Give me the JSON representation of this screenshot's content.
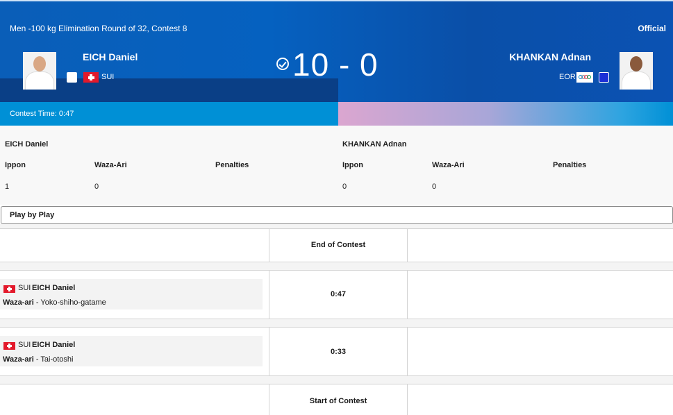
{
  "header": {
    "contest_title": "Men -100 kg Elimination Round of 32, Contest 8",
    "status": "Official",
    "contest_time": "Contest Time: 0:47",
    "score": "10 - 0"
  },
  "athletes": {
    "left": {
      "name": "EICH Daniel",
      "noc": "SUI",
      "judogi": "white",
      "judogi_color": "#ffffff"
    },
    "right": {
      "name": "KHANKAN Adnan",
      "noc": "EOR",
      "judogi": "blue",
      "judogi_color": "#1b2fd6"
    }
  },
  "stats": {
    "left": {
      "name": "EICH Daniel",
      "ippon_label": "Ippon",
      "wazaari_label": "Waza-Ari",
      "penalties_label": "Penalties",
      "ippon": "1",
      "wazaari": "0"
    },
    "right": {
      "name": "KHANKAN Adnan",
      "ippon_label": "Ippon",
      "wazaari_label": "Waza-Ari",
      "penalties_label": "Penalties",
      "ippon": "0",
      "wazaari": "0"
    }
  },
  "play_by_play": {
    "title": "Play by Play",
    "end_label": "End of Contest",
    "start_label": "Start of Contest",
    "events": [
      {
        "noc": "SUI",
        "athlete": "EICH Daniel",
        "score_type": "Waza-ari",
        "technique": " - Yoko-shiho-gatame",
        "time": "0:47"
      },
      {
        "noc": "SUI",
        "athlete": "EICH Daniel",
        "score_type": "Waza-ari",
        "technique": " - Tai-otoshi",
        "time": "0:33"
      }
    ]
  },
  "colors": {
    "hero_blue": "#0561c0",
    "swiss_red": "#e3192b"
  }
}
